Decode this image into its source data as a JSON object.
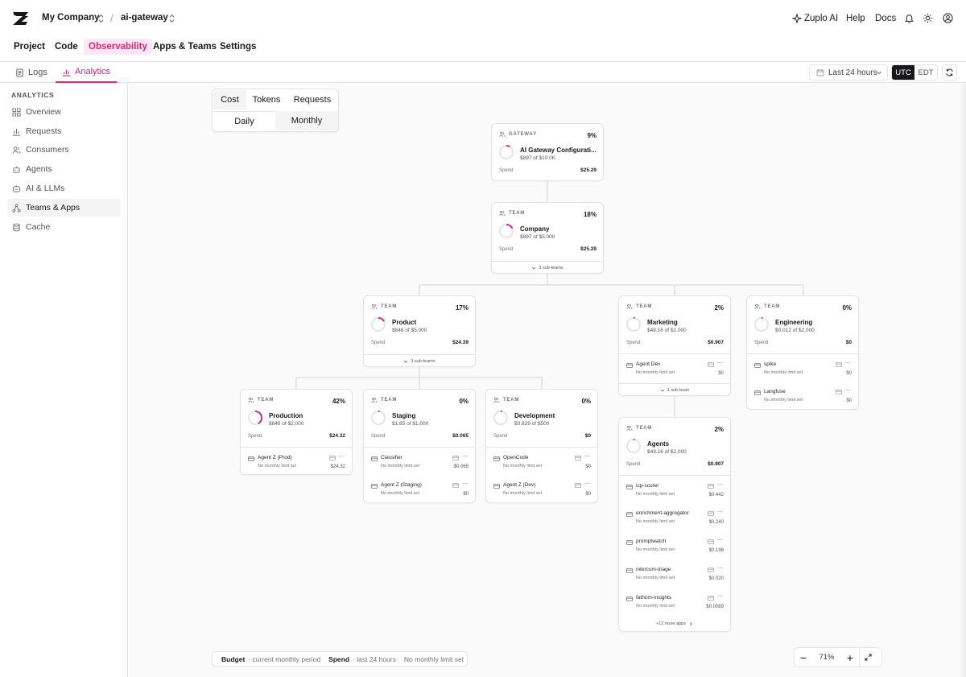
{
  "header": {
    "company": "My Company",
    "project": "ai-gateway",
    "zuplo_ai": "Zuplo AI",
    "help": "Help",
    "docs": "Docs"
  },
  "nav": {
    "tabs": [
      "Project",
      "Code",
      "Observability",
      "Apps & Teams",
      "Settings"
    ],
    "active": "Observability"
  },
  "subnav": {
    "logs": "Logs",
    "analytics": "Analytics",
    "time_range": "Last 24 hours",
    "tz_utc": "UTC",
    "tz_edt": "EDT"
  },
  "sidebar": {
    "heading": "ANALYTICS",
    "items": [
      {
        "label": "Overview",
        "icon": "grid-icon"
      },
      {
        "label": "Requests",
        "icon": "bar-chart-icon"
      },
      {
        "label": "Consumers",
        "icon": "users-icon"
      },
      {
        "label": "Agents",
        "icon": "bot-icon"
      },
      {
        "label": "AI & LLMs",
        "icon": "robot-icon"
      },
      {
        "label": "Teams & Apps",
        "icon": "network-icon",
        "active": true
      },
      {
        "label": "Cache",
        "icon": "database-icon"
      }
    ]
  },
  "metric_selector": {
    "metrics": [
      "Cost",
      "Tokens",
      "Requests"
    ],
    "periods": [
      "Daily",
      "Monthly"
    ],
    "active_metric": "Cost",
    "active_period": "Monthly"
  },
  "legend": {
    "budget": "Budget",
    "budget_desc": "· current monthly period",
    "spend": "Spend",
    "spend_desc": "· last 24 hours",
    "nolimit": "No monthly limit set"
  },
  "zoom": {
    "minus": "−",
    "value": "71%",
    "plus": "+"
  },
  "accent": "#db2777",
  "cards": {
    "gateway": {
      "type": "GATEWAY",
      "pct": "9%",
      "pct_value": 0.09,
      "name": "AI Gateway Configurati...",
      "budget": "$897 of $10.0K",
      "spend_label": "Spend",
      "spend": "$25.29"
    },
    "company": {
      "type": "TEAM",
      "pct": "18%",
      "pct_value": 0.18,
      "name": "Company",
      "budget": "$897 of $5,000",
      "spend_label": "Spend",
      "spend": "$25.29",
      "subteams": "3 sub-teams"
    },
    "product": {
      "type": "TEAM",
      "pct": "17%",
      "pct_value": 0.17,
      "name": "Product",
      "budget": "$848 of $5,000",
      "spend_label": "Spend",
      "spend": "$24.39",
      "subteams": "3 sub-teams"
    },
    "marketing": {
      "type": "TEAM",
      "pct": "2%",
      "pct_value": 0.02,
      "name": "Marketing",
      "budget": "$49.16 of $2,000",
      "spend_label": "Spend",
      "spend": "$0.907",
      "subteams": "1 sub-team",
      "apps": [
        {
          "name": "Agent Dev",
          "limit": "No monthly limit set",
          "dash": "—",
          "value": "$0"
        }
      ]
    },
    "engineering": {
      "type": "TEAM",
      "pct": "0%",
      "pct_value": 0.0,
      "name": "Engineering",
      "budget": "$0.012 of $2,000",
      "spend_label": "Spend",
      "spend": "$0",
      "apps": [
        {
          "name": "spike",
          "limit": "No monthly limit set",
          "dash": "—",
          "value": "$0"
        },
        {
          "name": "Langfuse",
          "limit": "No monthly limit set",
          "dash": "—",
          "value": "$0"
        }
      ]
    },
    "production": {
      "type": "TEAM",
      "pct": "42%",
      "pct_value": 0.42,
      "name": "Production",
      "budget": "$846 of $2,000",
      "spend_label": "Spend",
      "spend": "$24.32",
      "apps": [
        {
          "name": "Agent Z (Prod)",
          "limit": "No monthly limit set",
          "dash": "—",
          "value": "$24.32"
        }
      ]
    },
    "staging": {
      "type": "TEAM",
      "pct": "0%",
      "pct_value": 0.0,
      "name": "Staging",
      "budget": "$1.65 of $1,000",
      "spend_label": "Spend",
      "spend": "$0.065",
      "apps": [
        {
          "name": "Classifier",
          "limit": "No monthly limit set",
          "dash": "—",
          "value": "$0.065"
        },
        {
          "name": "Agent Z (Staging)",
          "limit": "No monthly limit set",
          "dash": "—",
          "value": "$0"
        }
      ]
    },
    "development": {
      "type": "TEAM",
      "pct": "0%",
      "pct_value": 0.0,
      "name": "Development",
      "budget": "$0.829 of $500",
      "spend_label": "Spend",
      "spend": "$0",
      "apps": [
        {
          "name": "OpenCode",
          "limit": "No monthly limit set",
          "dash": "—",
          "value": "$0"
        },
        {
          "name": "Agent Z (Dev)",
          "limit": "No monthly limit set",
          "dash": "—",
          "value": "$0"
        }
      ]
    },
    "agents": {
      "type": "TEAM",
      "pct": "2%",
      "pct_value": 0.02,
      "name": "Agents",
      "budget": "$49.16 of $2,000",
      "spend_label": "Spend",
      "spend": "$0.907",
      "apps": [
        {
          "name": "icp-scorer",
          "limit": "No monthly limit set",
          "dash": "—",
          "value": "$0.442"
        },
        {
          "name": "enrichment-aggregator",
          "limit": "No monthly limit set",
          "dash": "—",
          "value": "$0.240"
        },
        {
          "name": "promptwatch",
          "limit": "No monthly limit set",
          "dash": "—",
          "value": "$0.196"
        },
        {
          "name": "intercom-triage",
          "limit": "No monthly limit set",
          "dash": "—",
          "value": "$0.020"
        },
        {
          "name": "fathom-insights",
          "limit": "No monthly limit set",
          "dash": "—",
          "value": "$0.0089"
        }
      ],
      "more": "+12 more apps"
    }
  }
}
